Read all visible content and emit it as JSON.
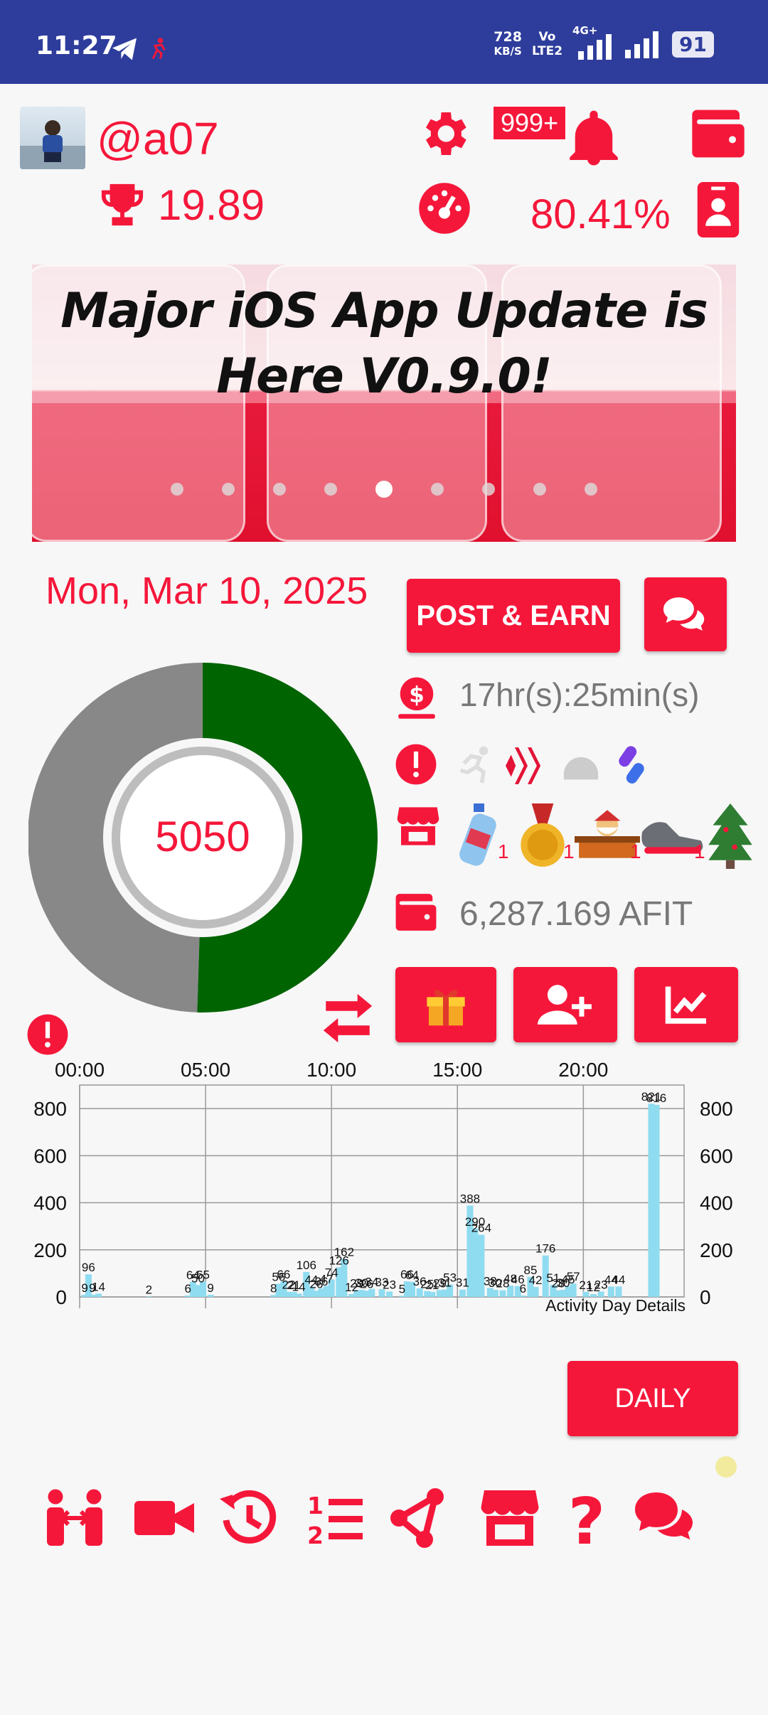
{
  "statusbar": {
    "time": "11:27",
    "netspeed_value": "728",
    "netspeed_unit": "KB/S",
    "volte_top": "Vo",
    "volte_bottom": "LTE2",
    "network": "4G+",
    "battery": "91"
  },
  "profile": {
    "username": "@a07",
    "trophy_value": "19.89",
    "notif_badge": "999+",
    "percent": "80.41%"
  },
  "banner": {
    "title_line1": "Major iOS App Update is",
    "title_line2": "Here V0.9.0!",
    "slides": 9,
    "active_slide": 4
  },
  "main": {
    "date": "Mon, Mar 10, 2025",
    "post_earn_label": "POST & EARN",
    "gauge_value": "5050",
    "gauge_fraction": 0.505,
    "timer": "17hr(s):25min(s)",
    "wallet": "6,287.169 AFIT",
    "shop_counts": [
      "1",
      "1",
      "1",
      "1"
    ],
    "daily_label": "DAILY"
  },
  "colors": {
    "accent": "#f5173a",
    "statusbar": "#2e3d9c",
    "gauge_fill": "#006400",
    "gauge_empty": "#888888",
    "bar": "#8fdcf0"
  },
  "icons": [
    "settings-gear-icon",
    "bell-icon",
    "wallet-icon",
    "trophy-icon",
    "speedometer-icon",
    "id-badge-icon",
    "dollar-coin-icon",
    "alert-icon",
    "store-icon",
    "wallet-icon",
    "gift-icon",
    "add-user-icon",
    "line-chart-icon",
    "swap-arrows-icon"
  ],
  "chart_data": {
    "type": "bar",
    "x_tick_labels": [
      "00:00",
      "05:00",
      "10:00",
      "15:00",
      "20:00"
    ],
    "y_tick_labels": [
      "0",
      "200",
      "400",
      "600",
      "800"
    ],
    "ylim": [
      0,
      900
    ],
    "xlim": [
      0,
      24
    ],
    "annotation": "Activity Day Details",
    "grid": true,
    "points": [
      {
        "x": 0.2,
        "v": 9
      },
      {
        "x": 0.35,
        "v": 96
      },
      {
        "x": 0.5,
        "v": 9
      },
      {
        "x": 0.75,
        "v": 14
      },
      {
        "x": 2.75,
        "v": 2
      },
      {
        "x": 4.3,
        "v": 6
      },
      {
        "x": 4.5,
        "v": 64
      },
      {
        "x": 4.7,
        "v": 50
      },
      {
        "x": 4.9,
        "v": 65
      },
      {
        "x": 5.2,
        "v": 9
      },
      {
        "x": 7.7,
        "v": 8
      },
      {
        "x": 7.9,
        "v": 56
      },
      {
        "x": 8.1,
        "v": 66
      },
      {
        "x": 8.3,
        "v": 22
      },
      {
        "x": 8.5,
        "v": 21
      },
      {
        "x": 8.7,
        "v": 14
      },
      {
        "x": 9.0,
        "v": 106
      },
      {
        "x": 9.2,
        "v": 44
      },
      {
        "x": 9.4,
        "v": 26
      },
      {
        "x": 9.6,
        "v": 36
      },
      {
        "x": 9.8,
        "v": 47
      },
      {
        "x": 10.0,
        "v": 74
      },
      {
        "x": 10.3,
        "v": 126
      },
      {
        "x": 10.5,
        "v": 162
      },
      {
        "x": 10.8,
        "v": 12
      },
      {
        "x": 11.0,
        "v": 29
      },
      {
        "x": 11.2,
        "v": 30
      },
      {
        "x": 11.4,
        "v": 26
      },
      {
        "x": 11.6,
        "v": 34
      },
      {
        "x": 12.0,
        "v": 33
      },
      {
        "x": 12.3,
        "v": 23
      },
      {
        "x": 12.8,
        "v": 5
      },
      {
        "x": 13.0,
        "v": 66
      },
      {
        "x": 13.2,
        "v": 64
      },
      {
        "x": 13.5,
        "v": 36
      },
      {
        "x": 13.8,
        "v": 25
      },
      {
        "x": 14.0,
        "v": 21
      },
      {
        "x": 14.3,
        "v": 29
      },
      {
        "x": 14.5,
        "v": 31
      },
      {
        "x": 14.7,
        "v": 53
      },
      {
        "x": 15.2,
        "v": 31
      },
      {
        "x": 15.5,
        "v": 388
      },
      {
        "x": 15.7,
        "v": 290
      },
      {
        "x": 15.95,
        "v": 264
      },
      {
        "x": 16.3,
        "v": 38
      },
      {
        "x": 16.5,
        "v": 30
      },
      {
        "x": 16.8,
        "v": 28
      },
      {
        "x": 17.1,
        "v": 48
      },
      {
        "x": 17.4,
        "v": 46
      },
      {
        "x": 17.6,
        "v": 6
      },
      {
        "x": 17.9,
        "v": 85
      },
      {
        "x": 18.1,
        "v": 42
      },
      {
        "x": 18.5,
        "v": 176
      },
      {
        "x": 18.8,
        "v": 51
      },
      {
        "x": 19.0,
        "v": 28
      },
      {
        "x": 19.2,
        "v": 30
      },
      {
        "x": 19.4,
        "v": 45
      },
      {
        "x": 19.6,
        "v": 57
      },
      {
        "x": 20.1,
        "v": 21
      },
      {
        "x": 20.4,
        "v": 12
      },
      {
        "x": 20.7,
        "v": 23
      },
      {
        "x": 21.1,
        "v": 44
      },
      {
        "x": 21.4,
        "v": 44
      },
      {
        "x": 22.7,
        "v": 821
      },
      {
        "x": 22.9,
        "v": 816
      }
    ]
  }
}
